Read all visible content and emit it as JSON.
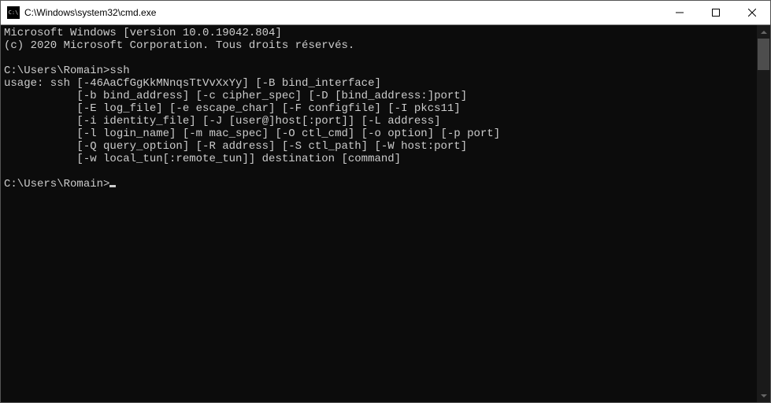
{
  "window": {
    "title": "C:\\Windows\\system32\\cmd.exe",
    "icon_label": "C:\\"
  },
  "terminal": {
    "lines": [
      "Microsoft Windows [version 10.0.19042.804]",
      "(c) 2020 Microsoft Corporation. Tous droits réservés.",
      "",
      "C:\\Users\\Romain>ssh",
      "usage: ssh [-46AaCfGgKkMNnqsTtVvXxYy] [-B bind_interface]",
      "           [-b bind_address] [-c cipher_spec] [-D [bind_address:]port]",
      "           [-E log_file] [-e escape_char] [-F configfile] [-I pkcs11]",
      "           [-i identity_file] [-J [user@]host[:port]] [-L address]",
      "           [-l login_name] [-m mac_spec] [-O ctl_cmd] [-o option] [-p port]",
      "           [-Q query_option] [-R address] [-S ctl_path] [-W host:port]",
      "           [-w local_tun[:remote_tun]] destination [command]",
      "",
      "C:\\Users\\Romain>"
    ]
  }
}
